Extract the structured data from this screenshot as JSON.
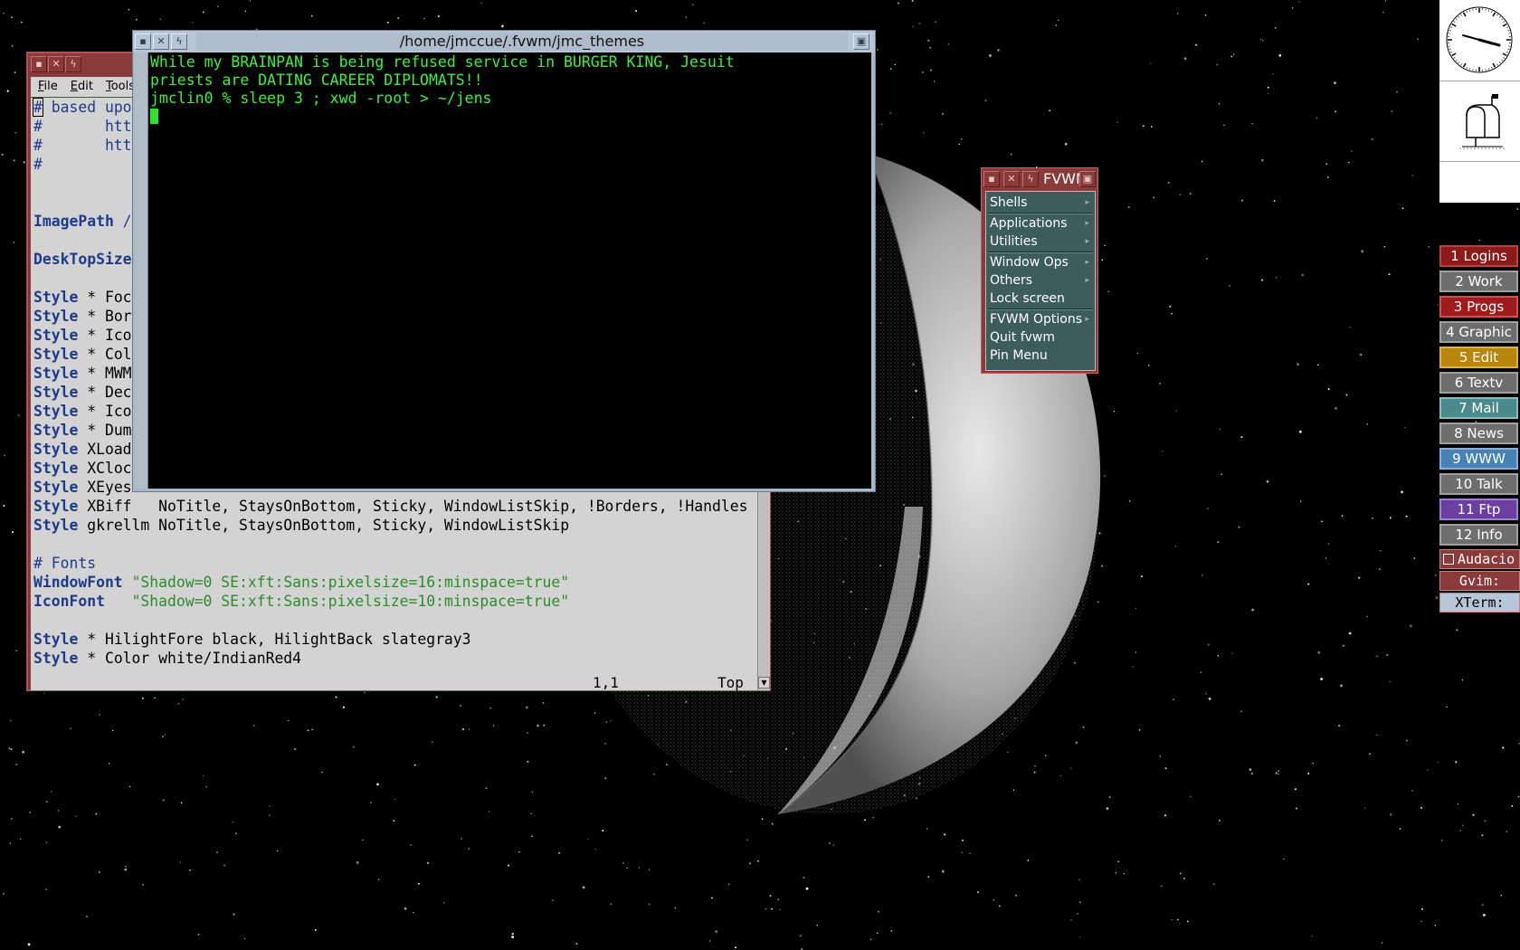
{
  "gvim": {
    "menu": [
      "File",
      "Edit",
      "Tools"
    ],
    "lines": [
      [
        {
          "t": "#",
          "c": "cm"
        },
        {
          "t": " based upo",
          "c": "cm"
        }
      ],
      [
        {
          "t": "#       htt",
          "c": "cm"
        }
      ],
      [
        {
          "t": "#       htt",
          "c": "cm"
        }
      ],
      [
        {
          "t": "#",
          "c": "cm"
        }
      ],
      [],
      [],
      [
        {
          "t": "ImagePath",
          "c": "kw"
        },
        {
          "t": " /",
          "c": "cm"
        }
      ],
      [],
      [
        {
          "t": "DeskTopSize",
          "c": "kw"
        }
      ],
      [],
      [
        {
          "t": "Style",
          "c": "kw"
        },
        {
          "t": " * Foc",
          "c": ""
        }
      ],
      [
        {
          "t": "Style",
          "c": "kw"
        },
        {
          "t": " * Bor",
          "c": ""
        }
      ],
      [
        {
          "t": "Style",
          "c": "kw"
        },
        {
          "t": " * Ico",
          "c": ""
        }
      ],
      [
        {
          "t": "Style",
          "c": "kw"
        },
        {
          "t": " * Col",
          "c": ""
        }
      ],
      [
        {
          "t": "Style",
          "c": "kw"
        },
        {
          "t": " * MWM",
          "c": ""
        }
      ],
      [
        {
          "t": "Style",
          "c": "kw"
        },
        {
          "t": " * Dec",
          "c": ""
        }
      ],
      [
        {
          "t": "Style",
          "c": "kw"
        },
        {
          "t": " * Ico",
          "c": ""
        }
      ],
      [
        {
          "t": "Style",
          "c": "kw"
        },
        {
          "t": " * Dum",
          "c": ""
        }
      ],
      [
        {
          "t": "Style",
          "c": "kw"
        },
        {
          "t": " XLoad",
          "c": ""
        }
      ],
      [
        {
          "t": "Style",
          "c": "kw"
        },
        {
          "t": " XCloc",
          "c": ""
        }
      ],
      [
        {
          "t": "Style",
          "c": "kw"
        },
        {
          "t": " XEyes",
          "c": ""
        }
      ],
      [
        {
          "t": "Style",
          "c": "kw"
        },
        {
          "t": " XBiff   NoTitle, StaysOnBottom, Sticky, WindowListSkip, !Borders, !Handles",
          "c": ""
        }
      ],
      [
        {
          "t": "Style",
          "c": "kw"
        },
        {
          "t": " gkrellm NoTitle, StaysOnBottom, Sticky, WindowListSkip",
          "c": ""
        }
      ],
      [],
      [
        {
          "t": "# Fonts",
          "c": "cm"
        }
      ],
      [
        {
          "t": "WindowFont",
          "c": "kw"
        },
        {
          "t": " ",
          "c": ""
        },
        {
          "t": "\"Shadow=0 SE:xft:Sans:pixelsize=16:minspace=true\"",
          "c": "st"
        }
      ],
      [
        {
          "t": "IconFont",
          "c": "kw"
        },
        {
          "t": "   ",
          "c": ""
        },
        {
          "t": "\"Shadow=0 SE:xft:Sans:pixelsize=10:minspace=true\"",
          "c": "st"
        }
      ],
      [],
      [
        {
          "t": "Style",
          "c": "kw"
        },
        {
          "t": " * HilightFore black, HilightBack slategray3",
          "c": ""
        }
      ],
      [
        {
          "t": "Style",
          "c": "kw"
        },
        {
          "t": " * Color white/IndianRed4",
          "c": ""
        }
      ]
    ],
    "status_pos": "1,1",
    "status_scroll": "Top"
  },
  "xterm": {
    "title": "/home/jmccue/.fvwm/jmc_themes",
    "lines": [
      "While my BRAINPAN is being refused service in BURGER KING, Jesuit",
      "priests are DATING CAREER DIPLOMATS!!",
      "jmclin0 % sleep 3 ; xwd -root > ~/jens"
    ],
    "text_color": "#3cf03c"
  },
  "fvwm_menu": {
    "title": "FVWM",
    "items": [
      {
        "label": "Shells",
        "sub": true
      },
      {
        "sep": true
      },
      {
        "label": "Applications",
        "sub": true
      },
      {
        "label": "Utilities",
        "sub": true
      },
      {
        "sep": true
      },
      {
        "label": "Window Ops",
        "sub": true
      },
      {
        "label": "Others",
        "sub": true
      },
      {
        "label": "Lock screen",
        "sub": false
      },
      {
        "sep": true
      },
      {
        "label": "FVWM Options",
        "sub": true
      },
      {
        "label": "Quit fvwm",
        "sub": false
      },
      {
        "label": "Pin Menu",
        "sub": false
      }
    ]
  },
  "pager": {
    "desks": [
      {
        "label": "1 Logins",
        "bg": "#8b1a1a",
        "border": "#c04040"
      },
      {
        "label": "2 Work",
        "bg": "#6e6e6e",
        "border": "#a0a0a0"
      },
      {
        "label": "3 Progs",
        "bg": "#a01c1c",
        "border": "#d05050"
      },
      {
        "label": "4 Graphic",
        "bg": "#6e6e6e",
        "border": "#a0a0a0"
      },
      {
        "label": "5 Edit",
        "bg": "#b8860b",
        "border": "#e0b040"
      },
      {
        "label": "6 Textv",
        "bg": "#6e6e6e",
        "border": "#a0a0a0"
      },
      {
        "label": "7 Mail",
        "bg": "#4a8a8a",
        "border": "#80c0c0"
      },
      {
        "label": "8 News",
        "bg": "#6e6e6e",
        "border": "#a0a0a0"
      },
      {
        "label": "9 WWW",
        "bg": "#4682b4",
        "border": "#80b0e0"
      },
      {
        "label": "10 Talk",
        "bg": "#6e6e6e",
        "border": "#a0a0a0"
      },
      {
        "label": "11 Ftp",
        "bg": "#6a3fa0",
        "border": "#a080d0"
      },
      {
        "label": "12 Info",
        "bg": "#6e6e6e",
        "border": "#a0a0a0"
      }
    ]
  },
  "tasklist": [
    {
      "label": "Audacio",
      "bg": "#8b3a3a",
      "fg": "#ffffff",
      "checkbox": true
    },
    {
      "label": "Gvim:",
      "bg": "#8b3a3a",
      "fg": "#ffffff",
      "checkbox": false
    },
    {
      "label": "XTerm:",
      "bg": "#b6c6d6",
      "fg": "#000000",
      "checkbox": false
    }
  ]
}
